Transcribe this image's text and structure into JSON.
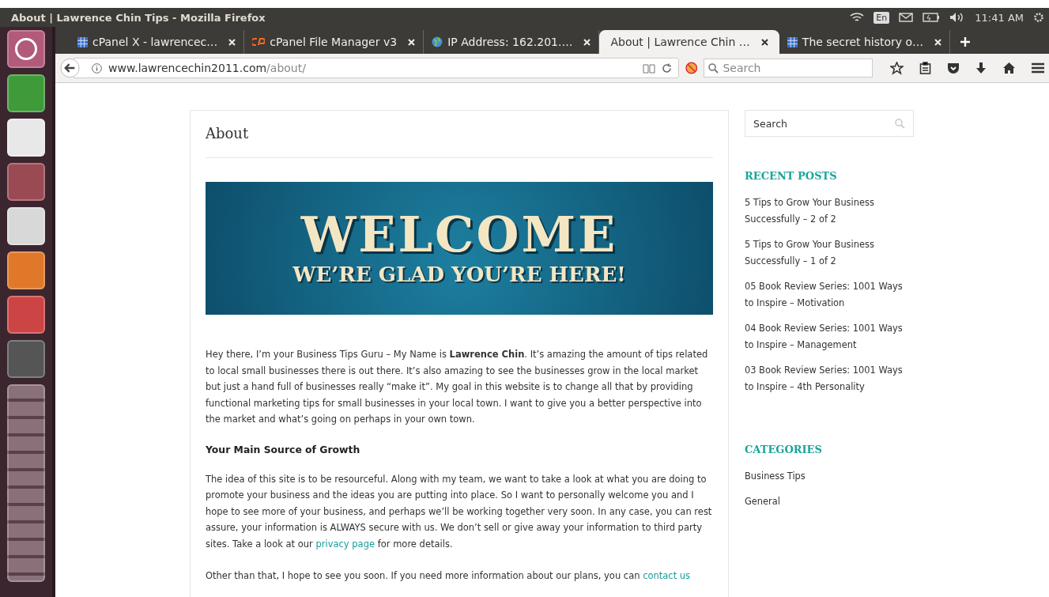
{
  "window": {
    "title": "About | Lawrence Chin Tips - Mozilla Firefox"
  },
  "system_tray": {
    "keyboard": "En",
    "clock": "11:41 AM"
  },
  "tabs": [
    {
      "label": "cPanel X - lawrencec…",
      "kind": "grid",
      "selected": false
    },
    {
      "label": "cPanel File Manager v3",
      "kind": "cp",
      "selected": false
    },
    {
      "label": "IP Address: 162.201.…",
      "kind": "globe",
      "selected": false
    },
    {
      "label": "About | Lawrence Chin …",
      "kind": "plain",
      "selected": true
    },
    {
      "label": "The secret history o…",
      "kind": "grid",
      "selected": false
    }
  ],
  "address_bar": {
    "host": "www.lawrencechin2011.com",
    "path": "/about/"
  },
  "browser_search": {
    "placeholder": "Search"
  },
  "launcher": {
    "apps": [
      {
        "kind": "ubuntu"
      },
      {
        "kind": "calc"
      },
      {
        "kind": "amazon"
      },
      {
        "kind": "files"
      },
      {
        "kind": "editor"
      },
      {
        "kind": "firefox"
      },
      {
        "kind": "reader"
      },
      {
        "kind": "settings"
      },
      {
        "kind": "stack"
      }
    ]
  },
  "post": {
    "title": "About",
    "banner": {
      "headline": "WELCOME",
      "subline": "WE’RE GLAD YOU’RE HERE!"
    },
    "blocks": [
      {
        "kind": "paragraph",
        "segments": [
          {
            "kind": "text",
            "text": "Hey there, I’m your Business Tips Guru – My Name is **Lawrence Chin**. It’s amazing the amount of tips related to local small businesses there is out there. It’s also amazing to see the businesses grow in the local market but just a hand full of businesses really “make it”. My goal in this website is to change all that by providing functional marketing tips for small businesses in your local town. I want to give you a better perspective into the market and what’s going on perhaps in your own town."
          }
        ]
      },
      {
        "kind": "heading",
        "text": "Your Main Source of Growth"
      },
      {
        "kind": "paragraph",
        "segments": [
          {
            "kind": "text",
            "text": "The idea of this site is to be resourceful. Along with my team, we want to take a look at what you are doing to promote your business and the ideas you are putting into place. So I want to personally welcome you and I hope to see more of your business, and perhaps we’ll be working together very soon. In any case, you can rest assure, your information is ALWAYS secure with us. We don’t sell or give away your information to third party sites. Take a look at our "
          },
          {
            "kind": "link",
            "text": "privacy page"
          },
          {
            "kind": "text",
            "text": " for more details."
          }
        ]
      },
      {
        "kind": "paragraph",
        "segments": [
          {
            "kind": "text",
            "text": "Other than that, I hope to see you soon. If you need more information about our plans, you can "
          },
          {
            "kind": "link",
            "text": "contact us"
          }
        ]
      }
    ]
  },
  "sidebar": {
    "search": {
      "placeholder": "Search"
    },
    "recent_posts": {
      "title": "RECENT POSTS",
      "items": [
        "5 Tips to Grow Your Business Successfully – 2 of 2",
        "5 Tips to Grow Your Business Successfully – 1 of 2",
        "05 Book Review Series: 1001 Ways to Inspire – Motivation",
        "04 Book Review Series: 1001 Ways to Inspire – Management",
        "03 Book Review Series: 1001 Ways to Inspire – 4th Personality"
      ]
    },
    "categories": {
      "title": "CATEGORIES",
      "items": [
        "Business Tips",
        "General"
      ]
    }
  }
}
